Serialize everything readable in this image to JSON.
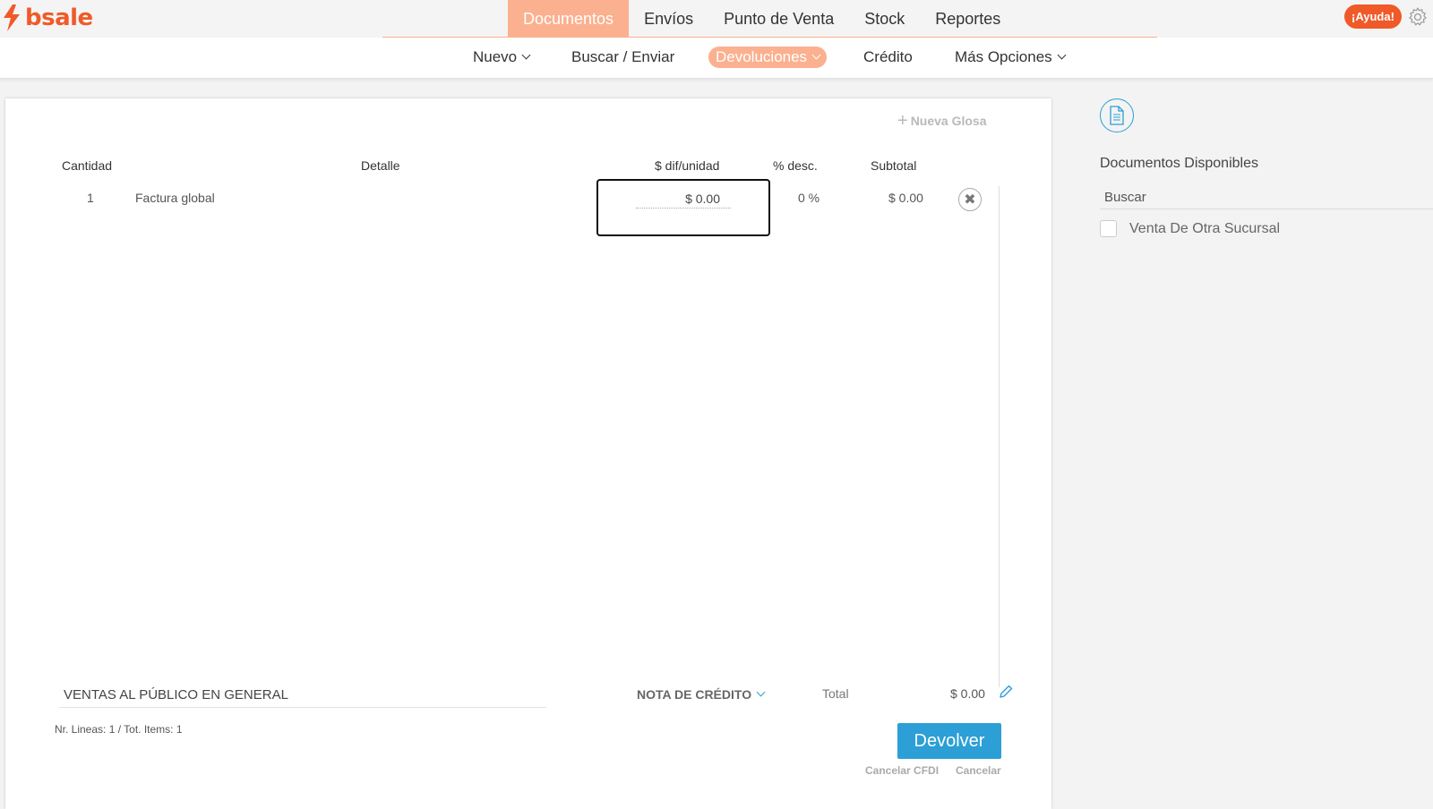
{
  "brand": {
    "name": "bsale",
    "color": "#f05a28"
  },
  "main_nav": [
    {
      "label": "Documentos",
      "active": true
    },
    {
      "label": "Envíos",
      "active": false
    },
    {
      "label": "Punto de Venta",
      "active": false
    },
    {
      "label": "Stock",
      "active": false
    },
    {
      "label": "Reportes",
      "active": false
    }
  ],
  "header": {
    "help_label": "¡Ayuda!",
    "settings_icon": "gear-icon"
  },
  "sub_nav": {
    "nuevo": "Nuevo",
    "buscar": "Buscar / Enviar",
    "devoluciones": "Devoluciones",
    "credito": "Crédito",
    "mas": "Más Opciones"
  },
  "document": {
    "nueva_glosa": "Nueva Glosa",
    "columns": {
      "cantidad": "Cantidad",
      "detalle": "Detalle",
      "dif_unidad": "$ dif/unidad",
      "desc": "% desc.",
      "subtotal": "Subtotal"
    },
    "rows": [
      {
        "cantidad": "1",
        "detalle": "Factura global",
        "dif_unidad": "$ 0.00",
        "desc": "0 %",
        "subtotal": "$ 0.00"
      }
    ],
    "client": "VENTAS AL PÚBLICO  EN GENERAL",
    "doc_type": "NOTA DE CRÉDITO",
    "total_label": "Total",
    "total_value": "$ 0.00",
    "lines_info": "Nr. Lineas: 1 / Tot. Items: 1",
    "submit_label": "Devolver",
    "cancel_cfdi": "Cancelar CFDI",
    "cancel": "Cancelar"
  },
  "sidebar": {
    "title": "Documentos Disponibles",
    "search_placeholder": "Buscar",
    "options": [
      {
        "label": "Venta De Otra Sucursal",
        "checked": false
      }
    ]
  },
  "colors": {
    "accent_soft": "#fbb08f",
    "primary_button": "#2b9fd6"
  }
}
